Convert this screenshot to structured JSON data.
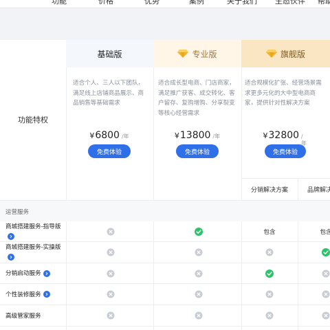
{
  "topnav": {
    "items": [
      "功能",
      "价格",
      "优势",
      "案例",
      "关于我们",
      "生态伙伴",
      "帮助"
    ]
  },
  "feature_title": "功能特权",
  "plans": [
    {
      "name": "基础版",
      "description": "适合个人、三人以下团队，满足线上店铺商品展示、商品销售等基础需求",
      "currency": "¥",
      "price": "6800",
      "unit": "/年",
      "button": "免费体验"
    },
    {
      "name": "专业版",
      "icon": "diamond-icon",
      "description": "适合成长型电商、门店商家，满足推广获客、成交转化、客户留存、复购增购、分享裂变等核心经营需求",
      "currency": "¥",
      "price": "13800",
      "unit": "/年",
      "button": "免费体验"
    },
    {
      "name": "旗舰版",
      "icon": "diamond-icon",
      "description": "适合规模化扩张、经营场景需求更多元化的大中型电商商家，提供针对性解决方案",
      "currency": "¥",
      "price": "32800",
      "unit": "/年",
      "button": "免费体验"
    }
  ],
  "flagship_subcolumns": [
    "分销解决方案",
    "品牌解决方案"
  ],
  "section": "运营服务",
  "status_icons": {
    "yes": "check-circle-icon",
    "no": "cross-circle-icon"
  },
  "included_text": "包含",
  "rows": [
    {
      "label": "商城搭建服务-指导版",
      "info": true,
      "cells": [
        "no",
        "yes",
        "text",
        "text"
      ]
    },
    {
      "label": "商城搭建服务-实操版",
      "info": true,
      "cells": [
        "no",
        "no",
        "no",
        "yes"
      ]
    },
    {
      "label": "分销启动服务",
      "info": true,
      "cells": [
        "no",
        "no",
        "yes",
        "no"
      ]
    },
    {
      "label": "个性装修服务",
      "info": true,
      "cells": [
        "no",
        "no",
        "no",
        "no"
      ]
    },
    {
      "label": "高级管家服务",
      "info": false,
      "cells": [
        "no",
        "no",
        "no",
        "no"
      ]
    }
  ],
  "colors": {
    "accent": "#2f6fe7",
    "check": "#2ec26b",
    "cross": "#c8ccd3",
    "pro_header_bg": "#fff6e8",
    "flag_header_bg": "#fbe6c3",
    "gold": "#f0b429"
  }
}
